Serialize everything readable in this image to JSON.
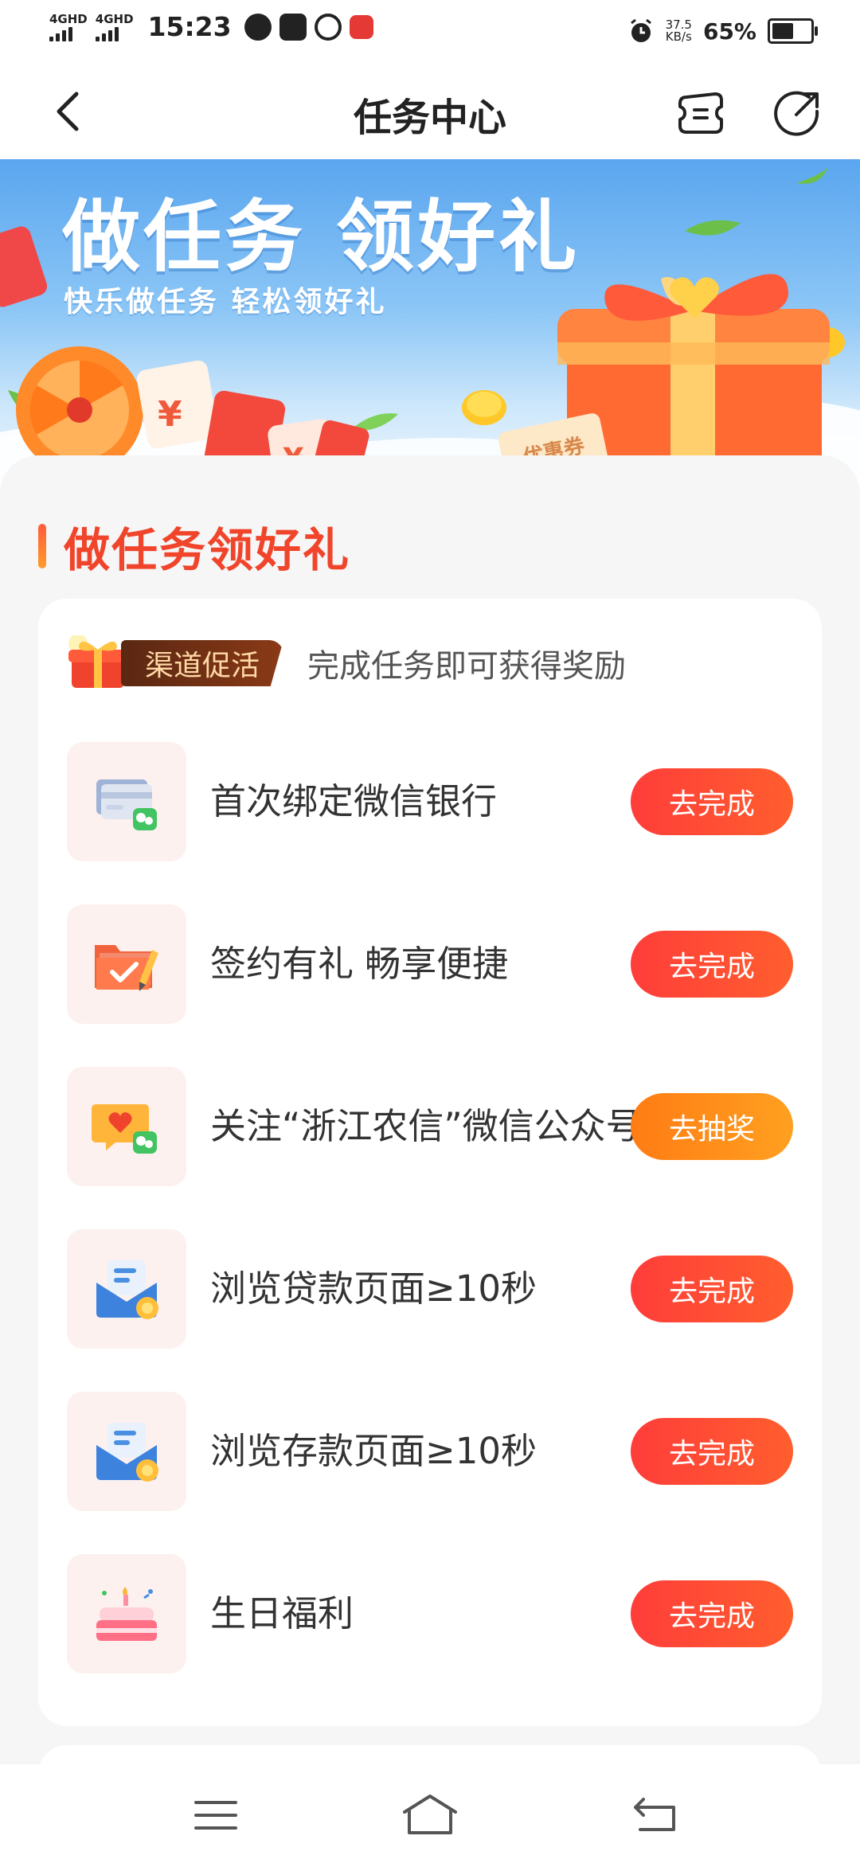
{
  "status_bar": {
    "sim1": "4GHD",
    "sim2": "4GHD",
    "time": "15:23",
    "speed_value": "37.5",
    "speed_unit": "KB/s",
    "battery": "65%",
    "battery_level": 0.65
  },
  "nav": {
    "title": "任务中心",
    "back_icon": "chevron-left-icon",
    "ticket_icon": "ticket-icon",
    "share_icon": "share-icon"
  },
  "banner": {
    "title": "做任务 领好礼",
    "subtitle": "快乐做任务  轻松领好礼",
    "coupon_text": "优惠券"
  },
  "section": {
    "title": "做任务领好礼"
  },
  "promo": {
    "badge": "渠道促活",
    "text": "完成任务即可获得奖励"
  },
  "tasks": [
    {
      "label": "首次绑定微信银行",
      "button": "去完成",
      "icon": "bank-card-wechat-icon",
      "style": "red"
    },
    {
      "label": "签约有礼 畅享便捷",
      "button": "去完成",
      "icon": "folder-sign-icon",
      "style": "red"
    },
    {
      "label": "关注“浙江农信”微信公众号",
      "button": "去抽奖",
      "icon": "wechat-heart-message-icon",
      "style": "orange"
    },
    {
      "label": "浏览贷款页面≥10秒",
      "button": "去完成",
      "icon": "mail-coin-icon",
      "style": "red"
    },
    {
      "label": "浏览存款页面≥10秒",
      "button": "去完成",
      "icon": "mail-coin-icon",
      "style": "red"
    },
    {
      "label": "生日福利",
      "button": "去完成",
      "icon": "birthday-cake-icon",
      "style": "red"
    }
  ],
  "colors": {
    "accent_red": "#ff4a35",
    "accent_orange": "#ff8a18",
    "title_red": "#f0452b"
  }
}
